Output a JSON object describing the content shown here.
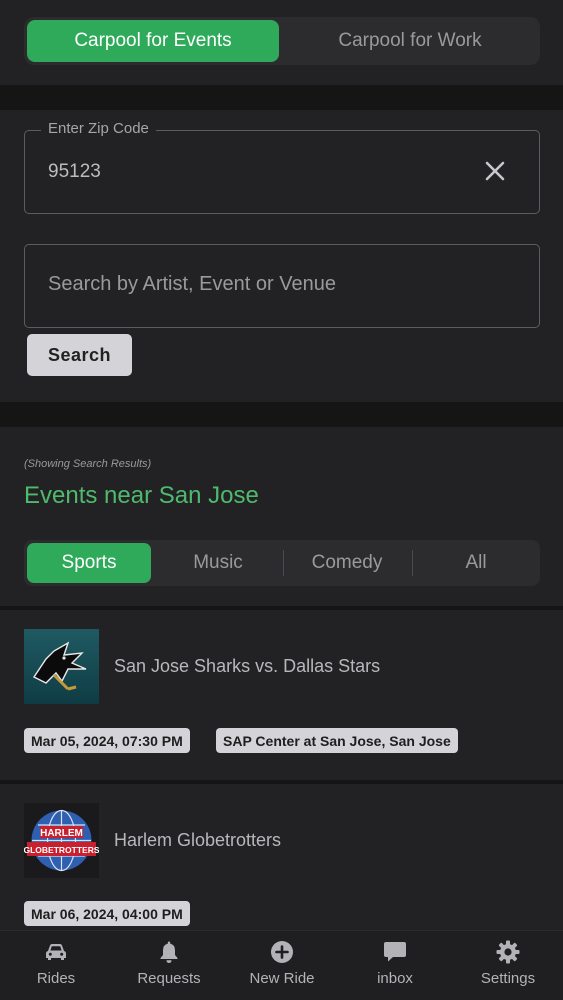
{
  "mode_toggle": {
    "options": [
      {
        "label": "Carpool for Events",
        "active": true
      },
      {
        "label": "Carpool for Work",
        "active": false
      }
    ]
  },
  "zip_field": {
    "legend": "Enter Zip Code",
    "value": "95123"
  },
  "search_field": {
    "placeholder": "Search by Artist, Event or Venue",
    "value": ""
  },
  "search_button": {
    "label": "Search"
  },
  "results": {
    "note": "(Showing Search Results)",
    "title": "Events near San Jose"
  },
  "categories": [
    {
      "label": "Sports",
      "active": true
    },
    {
      "label": "Music",
      "active": false
    },
    {
      "label": "Comedy",
      "active": false
    },
    {
      "label": "All",
      "active": false
    }
  ],
  "events": [
    {
      "title": "San Jose Sharks vs. Dallas Stars",
      "date": "Mar 05, 2024, 07:30 PM",
      "venue": "SAP Center at San Jose, San Jose",
      "thumb": "sharks-logo"
    },
    {
      "title": "Harlem Globetrotters",
      "date": "Mar 06, 2024, 04:00 PM",
      "venue": "",
      "thumb": "globetrotters-logo"
    }
  ],
  "tabbar": [
    {
      "label": "Rides",
      "icon": "car-icon"
    },
    {
      "label": "Requests",
      "icon": "bell-icon"
    },
    {
      "label": "New Ride",
      "icon": "plus-circle-icon"
    },
    {
      "label": "inbox",
      "icon": "chat-bubble-icon"
    },
    {
      "label": "Settings",
      "icon": "gear-icon"
    }
  ],
  "colors": {
    "accent": "#2eaa5a",
    "accent_text": "#4fb96d",
    "background": "#141414",
    "panel": "#222224"
  }
}
